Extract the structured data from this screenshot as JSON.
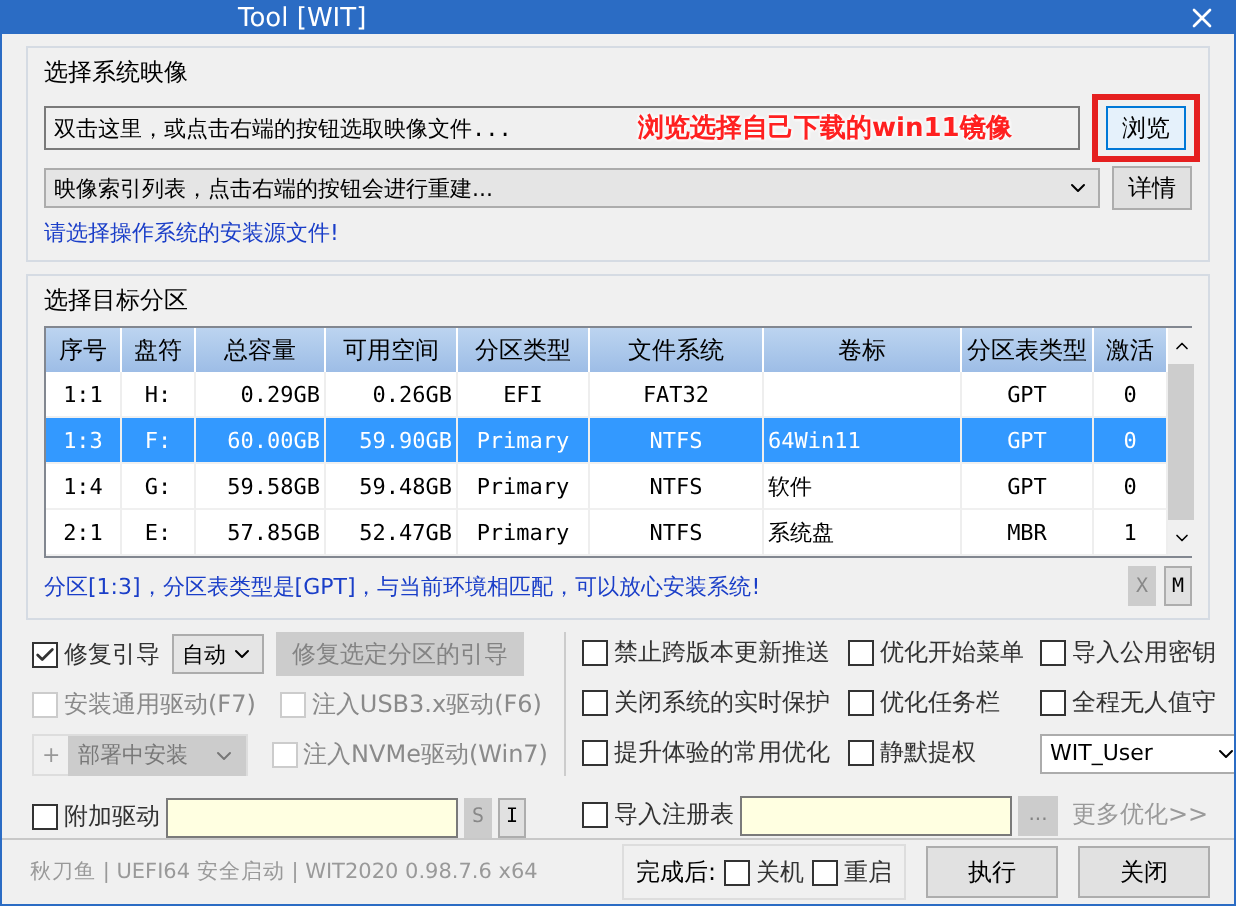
{
  "window": {
    "title": "Tool [WIT]"
  },
  "image_group": {
    "title": "选择系统映像",
    "file_field": {
      "placeholder": "双击这里，或点击右端的按钮选取映像文件..."
    },
    "browse_button": "浏览",
    "index_combo": {
      "value": "映像索引列表，点击右端的按钮会进行重建..."
    },
    "details_button": "详情",
    "hint": "请选择操作系统的安装源文件!"
  },
  "annotation": {
    "text": "浏览选择自己下载的win11镜像"
  },
  "partition_group": {
    "title": "选择目标分区",
    "table": {
      "columns": [
        "序号",
        "盘符",
        "总容量",
        "可用空间",
        "分区类型",
        "文件系统",
        "卷标",
        "分区表类型",
        "激活"
      ],
      "rows": [
        {
          "cells": [
            "1:1",
            "H:",
            "0.29GB",
            "0.26GB",
            "EFI",
            "FAT32",
            "",
            "GPT",
            "0"
          ],
          "selected": false
        },
        {
          "cells": [
            "1:3",
            "F:",
            "60.00GB",
            "59.90GB",
            "Primary",
            "NTFS",
            "64Win11",
            "GPT",
            "0"
          ],
          "selected": true
        },
        {
          "cells": [
            "1:4",
            "G:",
            "59.58GB",
            "59.48GB",
            "Primary",
            "NTFS",
            "软件",
            "GPT",
            "0"
          ],
          "selected": false
        },
        {
          "cells": [
            "2:1",
            "E:",
            "57.85GB",
            "52.47GB",
            "Primary",
            "NTFS",
            "系统盘",
            "MBR",
            "1"
          ],
          "selected": false
        }
      ]
    },
    "status": "分区[1:3]，分区表类型是[GPT]，与当前环境相匹配，可以放心安装系统!",
    "buttons": [
      {
        "label": "X",
        "disabled": true
      },
      {
        "label": "M",
        "disabled": false
      }
    ]
  },
  "options": {
    "repair_boot": {
      "label": "修复引导",
      "checked": true
    },
    "boot_mode": {
      "value": "自动"
    },
    "repair_button": {
      "label": "修复选定分区的引导",
      "disabled": true
    },
    "general_driver": {
      "label": "安装通用驱动(F7)",
      "checked": false,
      "disabled": true
    },
    "inject_checks": [
      {
        "label": "注入USB3.x驱动(F6)",
        "checked": false,
        "disabled": true
      },
      {
        "label": "注入NVMe驱动(Win7)",
        "checked": false,
        "disabled": true
      }
    ],
    "deploy": {
      "prefix": "+",
      "value": "部署中安装",
      "disabled": true
    },
    "right_checks": [
      {
        "label": "禁止跨版本更新推送",
        "checked": false,
        "disabled": false
      },
      {
        "label": "优化开始菜单",
        "checked": false,
        "disabled": false
      },
      {
        "label": "导入公用密钥",
        "checked": false,
        "disabled": false
      },
      {
        "label": "关闭系统的实时保护",
        "checked": false,
        "disabled": false
      },
      {
        "label": "优化任务栏",
        "checked": false,
        "disabled": false
      },
      {
        "label": "全程无人值守",
        "checked": false,
        "disabled": false
      },
      {
        "label": "提升体验的常用优化",
        "checked": false,
        "disabled": false
      },
      {
        "label": "静默提权",
        "checked": false,
        "disabled": false
      }
    ],
    "user_combo": {
      "value": "WIT_User"
    },
    "driver": {
      "label": "附加驱动",
      "checked": false,
      "buttons": [
        {
          "label": "S",
          "disabled": true
        },
        {
          "label": "I",
          "disabled": false
        }
      ]
    },
    "registry": {
      "label": "导入注册表",
      "checked": false,
      "button": {
        "label": "...",
        "disabled": true
      }
    },
    "more_link": "更多优化>>"
  },
  "status_bar": {
    "info": "秋刀鱼 | UEFI64 安全启动 | WIT2020 0.98.7.6 x64",
    "after_label": "完成后:",
    "after_checks": [
      {
        "label": "关机",
        "checked": false
      },
      {
        "label": "重启",
        "checked": false
      }
    ],
    "buttons": [
      "执行",
      "关闭"
    ]
  }
}
